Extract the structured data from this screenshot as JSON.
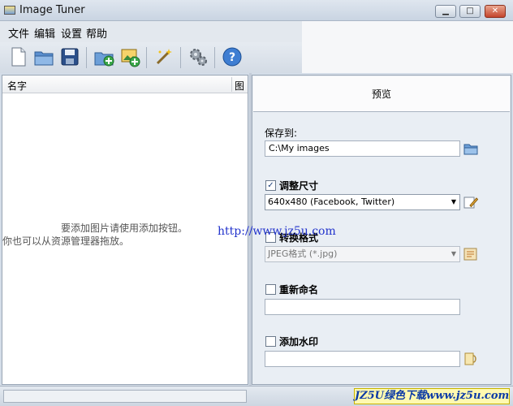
{
  "window": {
    "title": "Image Tuner",
    "min_label": "▁",
    "max_label": "□",
    "close_label": "✕"
  },
  "menu": {
    "file": "文件",
    "edit": "编辑",
    "settings": "设置",
    "help": "帮助"
  },
  "list": {
    "col_name": "名字",
    "col_image": "图",
    "empty_line1": "要添加图片请使用添加按钮。",
    "empty_line2": "你也可以从资源管理器拖放。"
  },
  "preview": {
    "label": "预览"
  },
  "save": {
    "label": "保存到:",
    "path": "C:\\My images"
  },
  "resize": {
    "label": "调整尺寸",
    "checked": "✓",
    "value": "640x480 (Facebook, Twitter)"
  },
  "convert": {
    "label": "转换格式",
    "value": "JPEG格式 (*.jpg)"
  },
  "rename": {
    "label": "重新命名",
    "value": ""
  },
  "watermark": {
    "label": "添加水印",
    "value": ""
  },
  "overlay": {
    "url": "http://www.jz5u.com"
  },
  "brand": {
    "text": "JZ5U绿色下载www.jz5u.com"
  },
  "icons": {
    "app": "app-icon",
    "new": "new-file-icon",
    "open": "open-folder-icon",
    "save": "save-disk-icon",
    "add_folder": "add-folder-icon",
    "add_image": "add-image-icon",
    "wand": "magic-wand-icon",
    "gears": "gears-icon",
    "help": "help-icon",
    "browse": "browse-folder-icon",
    "edit": "edit-pencil-icon",
    "format": "format-settings-icon",
    "watermark_pick": "watermark-pick-icon"
  }
}
